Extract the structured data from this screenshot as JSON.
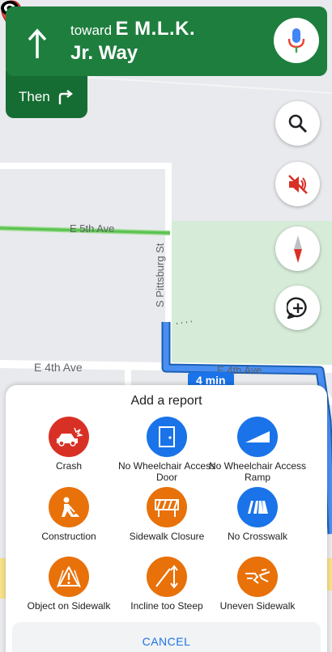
{
  "map": {
    "streets": {
      "fifth": "E 5th Ave",
      "fourth": "E 4th Ave",
      "fourth_b": "E 4th Ave",
      "pittsburg": "S Pittsburg St"
    },
    "route_time": "4 min"
  },
  "nav": {
    "toward": "toward",
    "street_line1": "E M.L.K.",
    "street_line2": "Jr. Way",
    "then": "Then",
    "banner_color": "#1e7e3e"
  },
  "buttons": {
    "search_icon": "search-icon",
    "mute_icon": "volume-off-icon",
    "compass_icon": "compass-icon",
    "add_icon": "add-report-icon"
  },
  "report": {
    "title": "Add a report",
    "items": [
      {
        "label": "Crash",
        "icon": "crash-icon",
        "color": "#d93025"
      },
      {
        "label": "No Wheelchair Access Door",
        "icon": "door-icon",
        "color": "#1a73e8"
      },
      {
        "label": "No Wheelchair Access Ramp",
        "icon": "ramp-icon",
        "color": "#1a73e8"
      },
      {
        "label": "Construction",
        "icon": "construction-icon",
        "color": "#e8710a"
      },
      {
        "label": "Sidewalk Closure",
        "icon": "barrier-icon",
        "color": "#e8710a"
      },
      {
        "label": "No Crosswalk",
        "icon": "crosswalk-icon",
        "color": "#1a73e8"
      },
      {
        "label": "Object on Sidewalk",
        "icon": "warning-cone-icon",
        "color": "#e8710a"
      },
      {
        "label": "Incline too Steep",
        "icon": "incline-icon",
        "color": "#e8710a"
      },
      {
        "label": "Uneven Sidewalk",
        "icon": "cracked-sidewalk-icon",
        "color": "#e8710a"
      }
    ],
    "cancel": "CANCEL"
  }
}
